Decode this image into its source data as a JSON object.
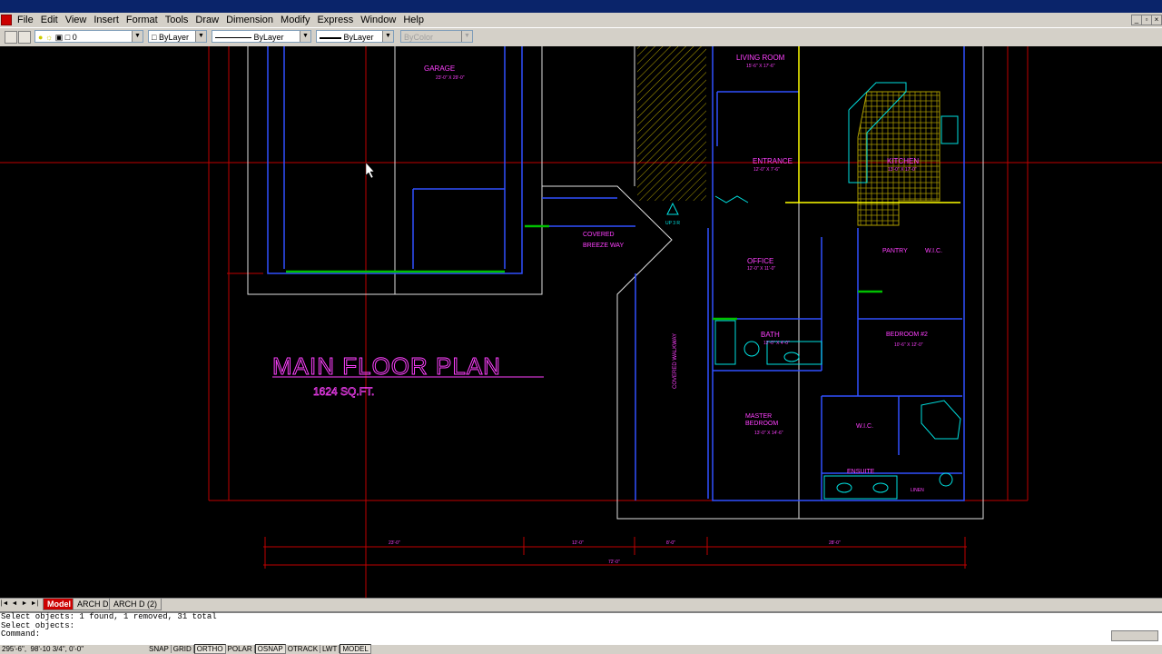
{
  "menu": [
    "File",
    "Edit",
    "View",
    "Insert",
    "Format",
    "Tools",
    "Draw",
    "Dimension",
    "Modify",
    "Express",
    "Window",
    "Help"
  ],
  "toolbar": {
    "layer_value": "0",
    "color_value": "ByLayer",
    "linetype_value": "ByLayer",
    "lineweight_value": "ByLayer",
    "plotstyle_value": "ByColor"
  },
  "drawing": {
    "title": "MAIN FLOOR PLAN",
    "subtitle": "1624 SQ.FT.",
    "rooms": {
      "garage": "GARAGE",
      "garage_dim": "23'-0\" X 29'-0\"",
      "living_room": "LIVING ROOM",
      "living_dim": "15'-6\" X 17'-6\"",
      "entrance": "ENTRANCE",
      "entrance_dim": "12'-0\" X 7'-6\"",
      "kitchen": "KITCHEN",
      "kitchen_dim": "13'-0\" X 17'-0\"",
      "covered_breeze": "COVERED",
      "covered_breeze2": "BREEZE WAY",
      "office": "OFFICE",
      "office_dim": "12'-0\" X 11'-0\"",
      "pantry": "PANTRY",
      "wic1": "W.I.C.",
      "bath": "BATH",
      "bath_dim": "12'-0\" X 4'-0\"",
      "bedroom2": "BEDROOM #2",
      "bedroom2_dim": "10'-6\" X 12'-0\"",
      "master": "MASTER",
      "master2": "BEDROOM",
      "master_dim": "13'-0\" X 14'-6\"",
      "wic2": "W.I.C.",
      "ensuite": "ENSUITE",
      "walkway": "COVERED WALKWAY",
      "up": "UP 3 R",
      "linen": "LINEN"
    },
    "dims": {
      "d1": "23'-0\"",
      "d2": "12'-0\"",
      "d3": "8'-0\"",
      "d4": "28'-0\"",
      "total": "72'-0\""
    }
  },
  "tabs": {
    "model": "Model",
    "layout1": "ARCH D",
    "layout2": "ARCH D (2)"
  },
  "command": {
    "line1": "Select objects: 1 found, 1 removed, 31 total",
    "line2": "Select objects:",
    "line3": "Command:"
  },
  "status": {
    "coords": "295'-6\",  98'-10 3/4\", 0'-0\"",
    "buttons": [
      "SNAP",
      "GRID",
      "ORTHO",
      "POLAR",
      "OSNAP",
      "OTRACK",
      "LWT",
      "MODEL"
    ]
  }
}
